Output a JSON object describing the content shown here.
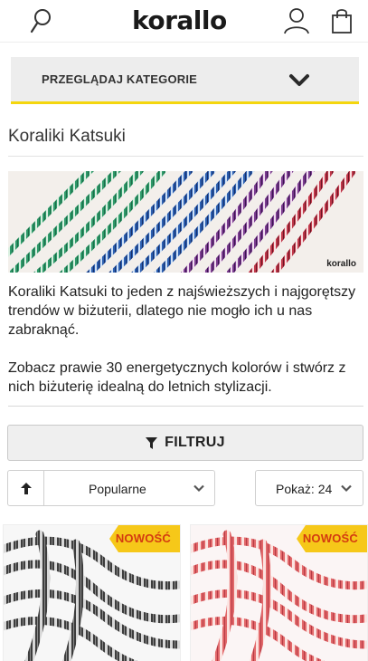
{
  "header": {
    "logo_text": "korallo",
    "icons": [
      "search-icon",
      "user-icon",
      "cart-icon"
    ]
  },
  "category_bar": {
    "label": "PRZEGLĄDAJ KATEGORIE"
  },
  "page": {
    "title": "Koraliki Katsuki",
    "banner_watermark": "korallo",
    "description_p1": "Koraliki Katsuki to jeden z najświeższych i najgorętszy trendów w biżuterii, dlatego nie mogło ich u nas zabraknąć.",
    "description_p2": "Zobacz prawie 30 energetycznych kolorów i stwórz z nich biżuterię idealną do letnich stylizacji."
  },
  "filter": {
    "label": "FILTRUJ"
  },
  "sort": {
    "selected": "Popularne",
    "show_selected": "Pokaż: 24"
  },
  "products": [
    {
      "badge": "NOWOŚĆ",
      "color": "#6b6b6b"
    },
    {
      "badge": "NOWOŚĆ",
      "color": "#e2686a"
    }
  ],
  "colors": {
    "accent": "#f4d60e",
    "badge_bg": "#f6c819",
    "badge_text": "#d43b10"
  }
}
